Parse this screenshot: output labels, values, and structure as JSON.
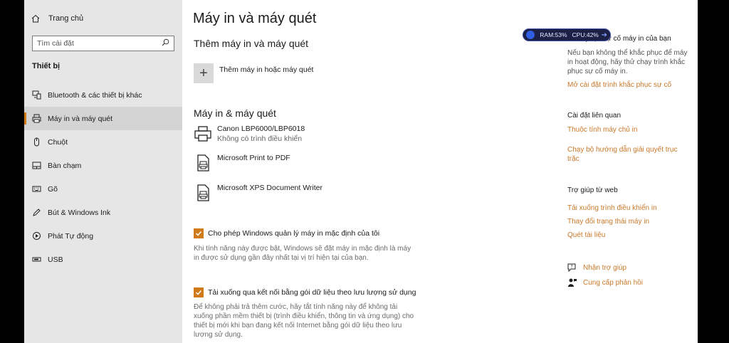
{
  "sidebar": {
    "home_label": "Trang chủ",
    "search_placeholder": "Tìm cài đặt",
    "section_label": "Thiết bị",
    "items": [
      {
        "label": "Bluetooth & các thiết bị khác",
        "icon": "bluetooth-devices-icon"
      },
      {
        "label": "Máy in và máy quét",
        "icon": "printer-icon"
      },
      {
        "label": "Chuột",
        "icon": "mouse-icon"
      },
      {
        "label": "Bàn chạm",
        "icon": "touchpad-icon"
      },
      {
        "label": "Gõ",
        "icon": "keyboard-icon"
      },
      {
        "label": "Bút & Windows Ink",
        "icon": "pen-icon"
      },
      {
        "label": "Phát Tự động",
        "icon": "autoplay-icon"
      },
      {
        "label": "USB",
        "icon": "usb-icon"
      }
    ]
  },
  "main": {
    "title": "Máy in và máy quét",
    "add_heading": "Thêm máy in và máy quét",
    "add_label": "Thêm máy in hoặc máy quét",
    "list_heading": "Máy in & máy quét",
    "printers": [
      {
        "name": "Canon LBP6000/LBP6018",
        "status": "Không có trình điều khiển"
      },
      {
        "name": "Microsoft Print to PDF",
        "status": ""
      },
      {
        "name": "Microsoft XPS Document Writer",
        "status": ""
      }
    ],
    "options": [
      {
        "label": "Cho phép Windows quản lý máy in mặc định của tôi",
        "checked": true,
        "desc": "Khi tính năng này được bật, Windows sẽ đặt máy in mặc định là máy in được sử dụng gần đây nhất tại vị trí hiện tại của bạn."
      },
      {
        "label": "Tải xuống qua kết nối bằng gói dữ liệu theo lưu lượng sử dụng",
        "checked": true,
        "desc": "Để không phải trả thêm cước, hãy tắt tính năng này để không tải xuống phần mềm thiết bị (trình điều khiển, thông tin và ứng dụng) cho thiết bị mới khi bạn đang kết nối Internet bằng gói dữ liệu theo lưu lượng sử dụng."
      }
    ]
  },
  "right": {
    "troubleshoot_heading": "Khắc phục sự cố máy in của bạn",
    "troubleshoot_text": "Nếu bạn không thể khắc phục để máy in hoạt động, hãy thử chạy trình khắc phục sự cố máy in.",
    "troubleshoot_link": "Mở cài đặt trình khắc phục sự cố",
    "related_heading": "Cài đặt liên quan",
    "related_links": [
      "Thuộc tính máy chủ in",
      "Chạy bộ hướng dẫn giải quyết trục trặc"
    ],
    "web_help_heading": "Trợ giúp từ web",
    "web_help_links": [
      "Tải xuống trình điều khiển in",
      "Thay đổi trạng thái máy in",
      "Quét tài liệu"
    ],
    "get_help": "Nhận trợ giúp",
    "feedback": "Cung cấp phản hồi"
  },
  "widget": {
    "ram": "RAM:53%",
    "cpu": "CPU:42%"
  },
  "colors": {
    "accent": "#d07a1a",
    "link": "#c8782a",
    "sidebar_bg": "#e6e6e6"
  }
}
